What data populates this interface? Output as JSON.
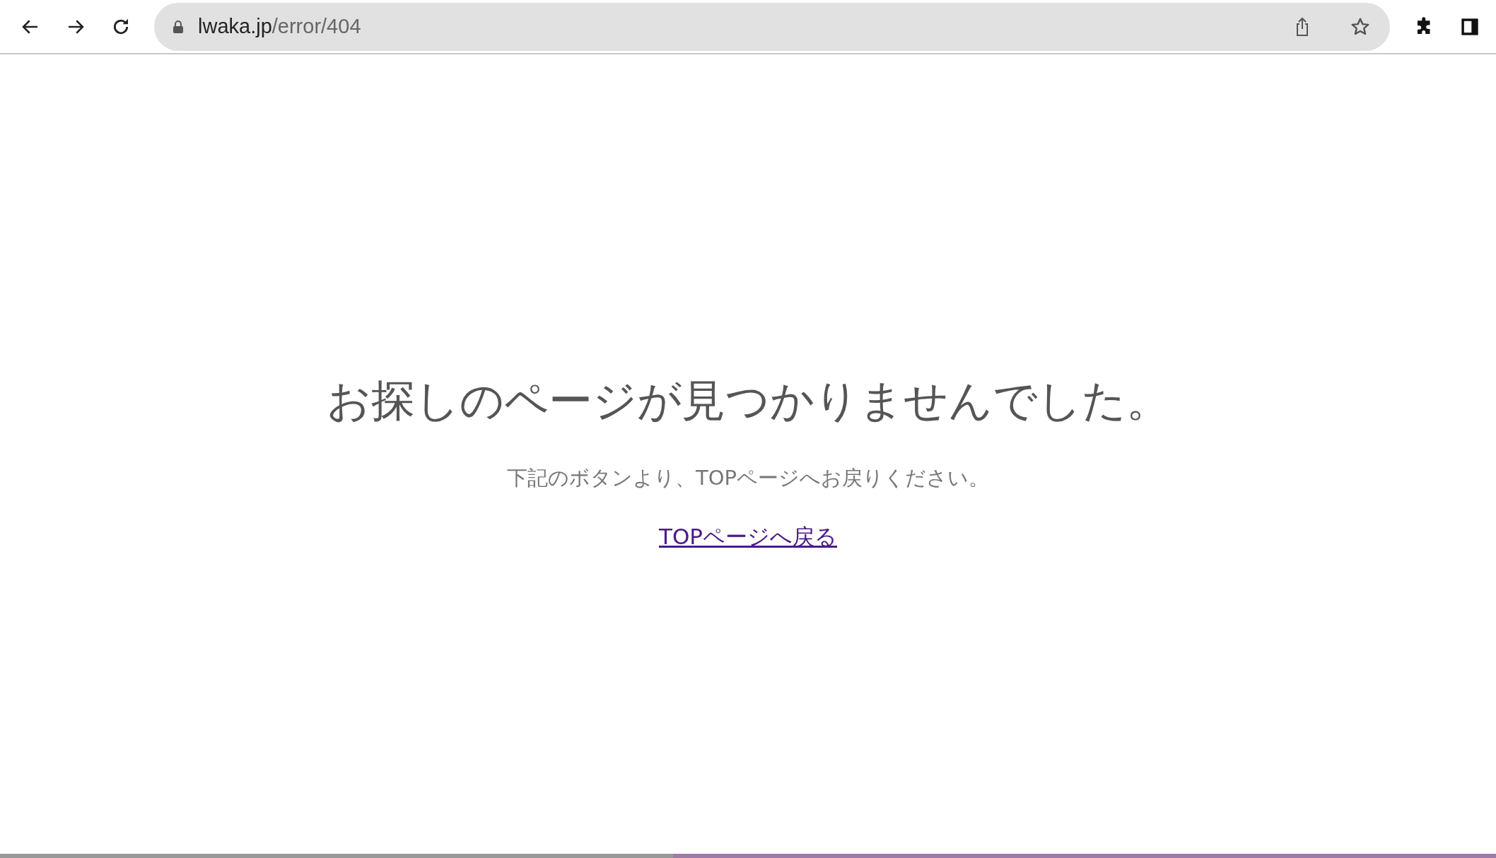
{
  "toolbar": {
    "url_host": "lwaka.jp",
    "url_path": "/error/404"
  },
  "page": {
    "heading": "お探しのページが見つかりませんでした。",
    "message": "下記のボタンより、TOPページへお戻りください。",
    "link": "TOPページへ戻る"
  }
}
